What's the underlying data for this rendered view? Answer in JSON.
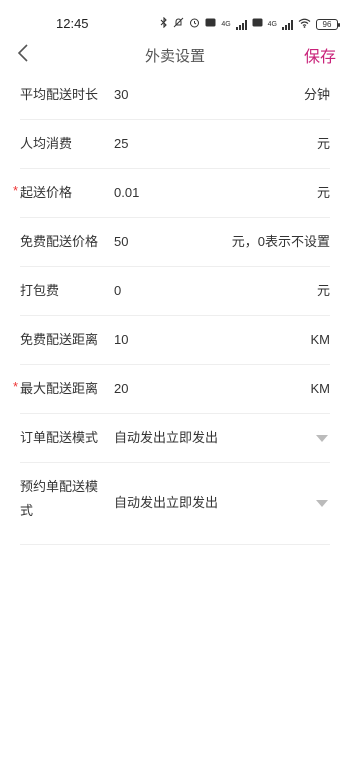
{
  "status": {
    "time": "12:45",
    "network": "4G",
    "battery": "96",
    "icons": [
      "bluetooth-icon",
      "mute-icon",
      "alarm-icon",
      "hd-icon",
      "signal-icon",
      "wifi-icon",
      "battery-icon"
    ]
  },
  "header": {
    "title": "外卖设置",
    "save_label": "保存",
    "back_icon": "chevron-left-icon"
  },
  "colors": {
    "accent": "#c9227a",
    "required": "#e33333",
    "divider": "#eeeeee"
  },
  "form": {
    "rows": [
      {
        "label": "平均配送时长",
        "value": "30",
        "unit": "分钟",
        "required": false
      },
      {
        "label": "人均消费",
        "value": "25",
        "unit": "元",
        "required": false
      },
      {
        "label": "起送价格",
        "value": "0.01",
        "unit": "元",
        "required": true,
        "required_mark": "*"
      },
      {
        "label": "免费配送价格",
        "value": "50",
        "unit": "元，0表示不设置",
        "required": false
      },
      {
        "label": "打包费",
        "value": "0",
        "unit": "元",
        "required": false
      },
      {
        "label": "免费配送距离",
        "value": "10",
        "unit": "KM",
        "required": false
      },
      {
        "label": "最大配送距离",
        "value": "20",
        "unit": "KM",
        "required": true,
        "required_mark": "*"
      },
      {
        "label": "订单配送模式",
        "value": "自动发出立即发出",
        "type": "select",
        "required": false
      },
      {
        "label": "预约单配送模式",
        "value": "自动发出立即发出",
        "type": "select",
        "required": false
      }
    ]
  }
}
